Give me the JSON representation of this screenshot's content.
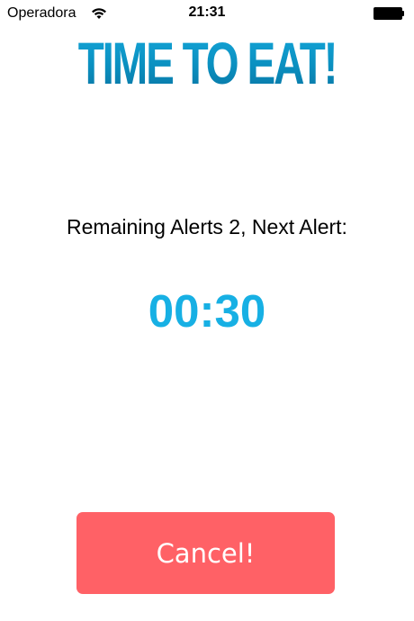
{
  "status_bar": {
    "carrier": "Operadora",
    "time": "21:31",
    "wifi_icon": "wifi-icon",
    "battery_icon": "battery-icon"
  },
  "title": "TIME TO EAT!",
  "remaining_text": "Remaining Alerts 2, Next Alert:",
  "countdown": "00:30",
  "cancel_label": "Cancel!",
  "colors": {
    "title_blue": "#0a8fbd",
    "countdown_blue": "#17b0e4",
    "cancel_red": "#ff6166"
  }
}
